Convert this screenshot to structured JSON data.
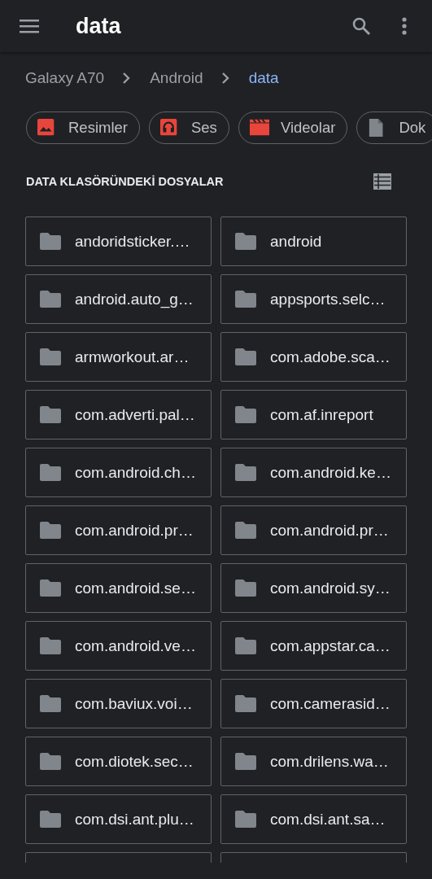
{
  "app_bar": {
    "title": "data"
  },
  "breadcrumb": [
    {
      "label": "Galaxy A70",
      "selected": false
    },
    {
      "label": "Android",
      "selected": false
    },
    {
      "label": "data",
      "selected": true
    }
  ],
  "categories": [
    {
      "label": "Resimler",
      "kind": "image"
    },
    {
      "label": "Ses",
      "kind": "audio"
    },
    {
      "label": "Videolar",
      "kind": "video"
    },
    {
      "label": "Dok",
      "kind": "document"
    }
  ],
  "section": {
    "title": "DATA KLASÖRÜNDEKİ DOSYALAR"
  },
  "folders": [
    {
      "name": "andoridsticker.…"
    },
    {
      "name": "android"
    },
    {
      "name": "android.auto_g…"
    },
    {
      "name": "appsports.selc…"
    },
    {
      "name": "armworkout.ar…"
    },
    {
      "name": "com.adobe.sca…"
    },
    {
      "name": "com.adverti.pal…"
    },
    {
      "name": "com.af.inreport"
    },
    {
      "name": "com.android.ch…"
    },
    {
      "name": "com.android.ke…"
    },
    {
      "name": "com.android.pr…"
    },
    {
      "name": "com.android.pr…"
    },
    {
      "name": "com.android.se…"
    },
    {
      "name": "com.android.sy…"
    },
    {
      "name": "com.android.ve…"
    },
    {
      "name": "com.appstar.ca…"
    },
    {
      "name": "com.baviux.voi…"
    },
    {
      "name": "com.camerasid…"
    },
    {
      "name": "com.diotek.sec…"
    },
    {
      "name": "com.drilens.wa…"
    },
    {
      "name": "com.dsi.ant.plu…"
    },
    {
      "name": "com.dsi.ant.sa…"
    }
  ]
}
